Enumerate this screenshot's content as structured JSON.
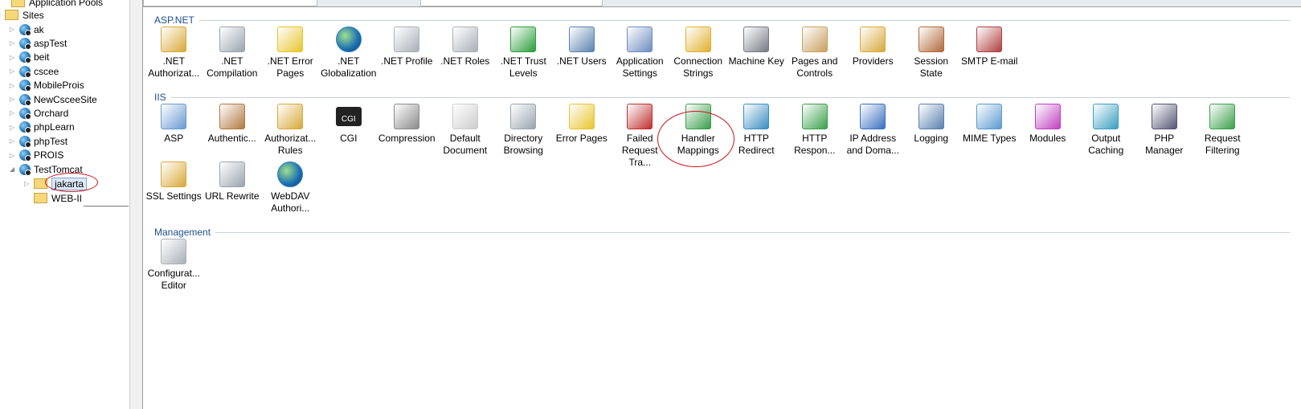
{
  "tree": {
    "top_item": "Application Pools",
    "sites_label": "Sites",
    "sites": [
      "ak",
      "aspTest",
      "beit",
      "cscee",
      "MobileProis",
      "NewCsceeSite",
      "Orchard",
      "phpLearn",
      "phpTest",
      "PROIS",
      "TestTomcat"
    ],
    "children": [
      "jakarta",
      "WEB-II"
    ]
  },
  "sections": [
    {
      "title": "ASP.NET",
      "rows": [
        [
          {
            "label": ".NET Authorizat...",
            "icon": "lock-icon",
            "color": "#d8a93a"
          },
          {
            "label": ".NET Compilation",
            "icon": "stack-icon",
            "color": "#9aa4ae"
          },
          {
            "label": ".NET Error Pages",
            "icon": "error-404-icon",
            "color": "#e8c42c"
          },
          {
            "label": ".NET Globalization",
            "icon": "globe-icon",
            "color": "#2a7fc4"
          },
          {
            "label": ".NET Profile",
            "icon": "profile-icon",
            "color": "#aab0b8"
          },
          {
            "label": ".NET Roles",
            "icon": "roles-icon",
            "color": "#aab0b8"
          },
          {
            "label": ".NET Trust Levels",
            "icon": "trust-icon",
            "color": "#2a9e3a"
          },
          {
            "label": ".NET Users",
            "icon": "users-icon",
            "color": "#5a83b0"
          },
          {
            "label": "Application Settings",
            "icon": "settings-list-icon",
            "color": "#6c8cc0"
          },
          {
            "label": "Connection Strings",
            "icon": "database-icon",
            "color": "#e0b030"
          },
          {
            "label": "Machine Key",
            "icon": "key-icon",
            "color": "#777c84"
          },
          {
            "label": "Pages and Controls",
            "icon": "pages-icon",
            "color": "#c8a060"
          },
          {
            "label": "Providers",
            "icon": "providers-icon",
            "color": "#d8a93a"
          },
          {
            "label": "Session State",
            "icon": "session-icon",
            "color": "#b06a3a"
          },
          {
            "label": "SMTP E-mail",
            "icon": "email-icon",
            "color": "#b04040"
          }
        ]
      ]
    },
    {
      "title": "IIS",
      "rows": [
        [
          {
            "label": "ASP",
            "icon": "asp-icon",
            "color": "#6a9ad0"
          },
          {
            "label": "Authentic...",
            "icon": "authentication-icon",
            "color": "#b07a40"
          },
          {
            "label": "Authorizat... Rules",
            "icon": "lock-icon",
            "color": "#d8a93a"
          },
          {
            "label": "CGI",
            "icon": "cgi-icon",
            "color": "#222222"
          },
          {
            "label": "Compression",
            "icon": "compression-icon",
            "color": "#8a8a8a"
          },
          {
            "label": "Default Document",
            "icon": "document-icon",
            "color": "#cccccc"
          },
          {
            "label": "Directory Browsing",
            "icon": "directory-icon",
            "color": "#9aa4ae"
          },
          {
            "label": "Error Pages",
            "icon": "error-404-icon",
            "color": "#e8c42c"
          },
          {
            "label": "Failed Request Tra...",
            "icon": "failed-request-icon",
            "color": "#c03030"
          },
          {
            "label": "Handler Mappings",
            "icon": "handler-icon",
            "color": "#3a9e4a"
          },
          {
            "label": "HTTP Redirect",
            "icon": "redirect-icon",
            "color": "#3a8ec0"
          },
          {
            "label": "HTTP Respon...",
            "icon": "response-icon",
            "color": "#3aa04a"
          },
          {
            "label": "IP Address and Doma...",
            "icon": "ip-icon",
            "color": "#3a70c0"
          },
          {
            "label": "Logging",
            "icon": "logging-icon",
            "color": "#5a80b0"
          },
          {
            "label": "MIME Types",
            "icon": "mime-icon",
            "color": "#5a9ad0"
          },
          {
            "label": "Modules",
            "icon": "modules-icon",
            "color": "#c040c0"
          },
          {
            "label": "Output Caching",
            "icon": "caching-icon",
            "color": "#3a9ec0"
          },
          {
            "label": "PHP Manager",
            "icon": "php-icon",
            "color": "#555577"
          },
          {
            "label": "Request Filtering",
            "icon": "filter-icon",
            "color": "#3aa04a"
          }
        ],
        [
          {
            "label": "SSL Settings",
            "icon": "lock-icon",
            "color": "#d8a93a"
          },
          {
            "label": "URL Rewrite",
            "icon": "rewrite-icon",
            "color": "#9aa4ae"
          },
          {
            "label": "WebDAV Authori...",
            "icon": "webdav-icon",
            "color": "#2a7fc4"
          }
        ]
      ]
    },
    {
      "title": "Management",
      "rows": [
        [
          {
            "label": "Configurat... Editor",
            "icon": "config-editor-icon",
            "color": "#aab0b8"
          }
        ]
      ]
    }
  ]
}
